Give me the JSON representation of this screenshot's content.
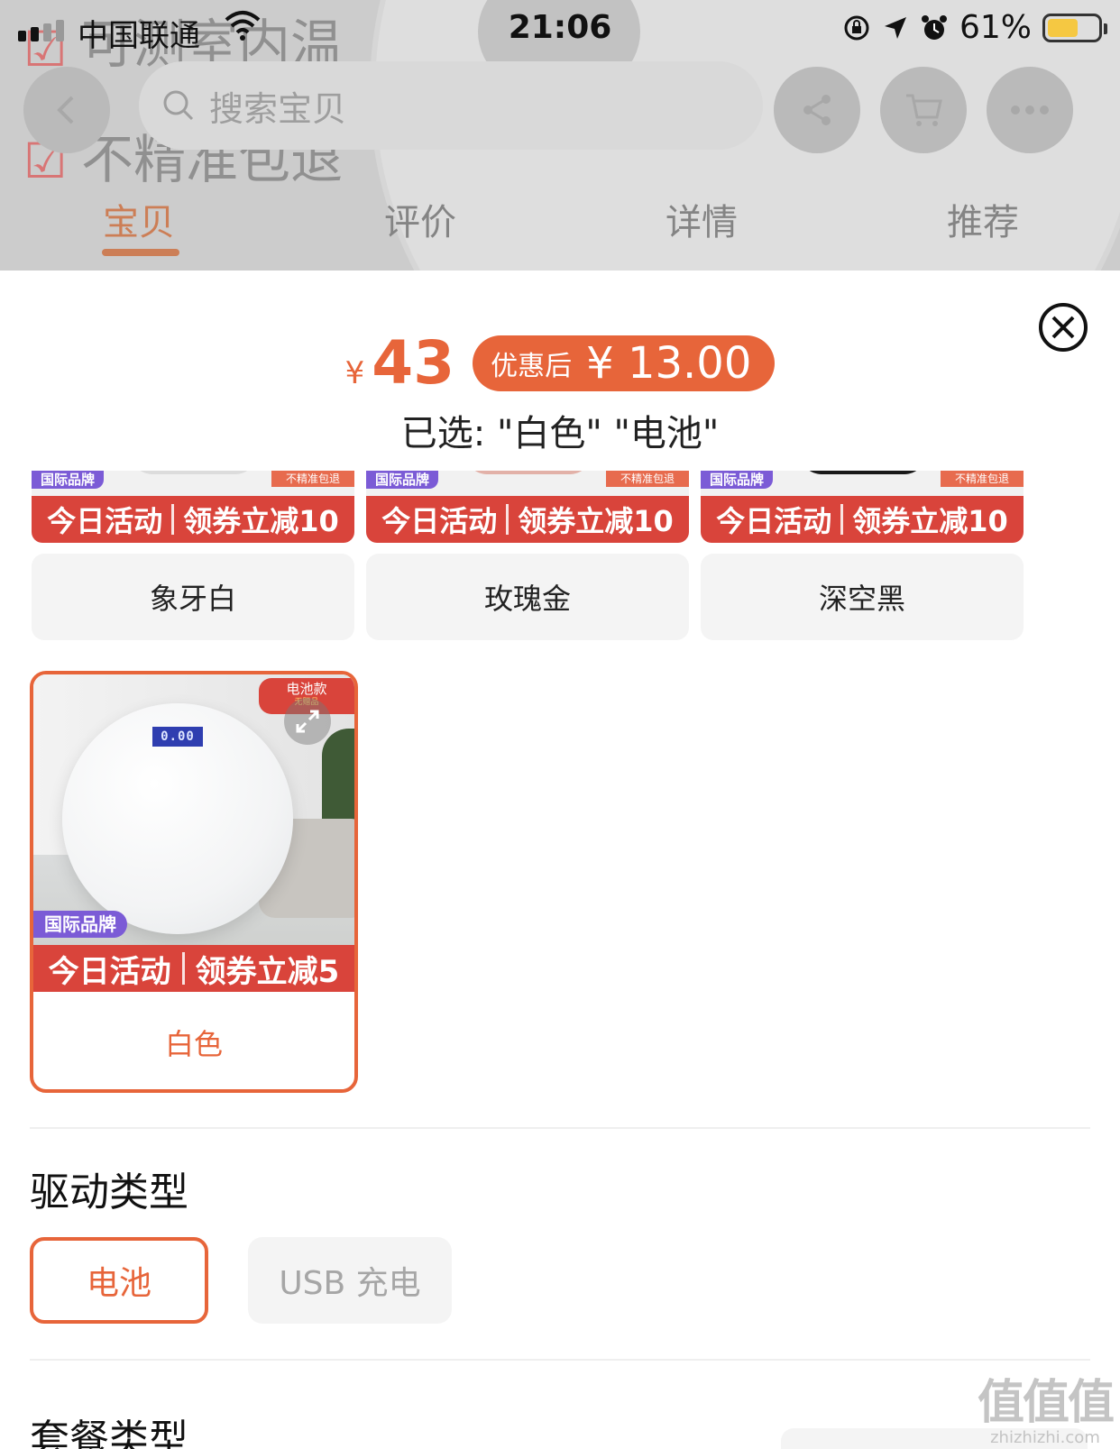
{
  "status_bar": {
    "carrier": "中国联通",
    "time": "21:06",
    "battery": "61%",
    "battery_level": 0.61,
    "battery_color": "#f5c842"
  },
  "background_page": {
    "checklist": [
      "可测室内温",
      "不精准包退"
    ],
    "search_placeholder": "搜索宝贝",
    "tabs": [
      {
        "label": "宝贝",
        "active": true
      },
      {
        "label": "评价",
        "active": false
      },
      {
        "label": "详情",
        "active": false
      },
      {
        "label": "推荐",
        "active": false
      }
    ]
  },
  "sheet": {
    "price": {
      "symbol": "¥",
      "value": "43",
      "coupon_label": "优惠后",
      "coupon_price": "¥ 13.00",
      "accent_color": "#e7653a"
    },
    "selected_text": "已选: \"白色\" \"电池\"",
    "color_options": [
      {
        "label": "象牙白",
        "brand_tag": "国际品牌",
        "return_tag": "不精准包退",
        "promo_left": "今日活动",
        "promo_right": "领券立减10",
        "disc_color": "#dcdcdc",
        "selected": false
      },
      {
        "label": "玫瑰金",
        "brand_tag": "国际品牌",
        "return_tag": "不精准包退",
        "promo_left": "今日活动",
        "promo_right": "领券立减10",
        "disc_color": "#e2b1a8",
        "selected": false
      },
      {
        "label": "深空黑",
        "brand_tag": "国际品牌",
        "return_tag": "不精准包退",
        "promo_left": "今日活动",
        "promo_right": "领券立减10",
        "disc_color": "#1a1a1a",
        "selected": false
      }
    ],
    "selected_color": {
      "label": "白色",
      "badge": "电池款",
      "badge_sub": "无赠品",
      "display_reading": "0.00",
      "brand_tag": "国际品牌",
      "promo_left": "今日活动",
      "promo_right": "领券立减5"
    },
    "drive_type": {
      "title": "驱动类型",
      "options": [
        {
          "label": "电池",
          "selected": true
        },
        {
          "label": "USB 充电",
          "selected": false
        }
      ]
    },
    "next_section_title": "套餐类型"
  },
  "watermark": {
    "mark": "值值值",
    "url": "zhizhizhi.com"
  }
}
